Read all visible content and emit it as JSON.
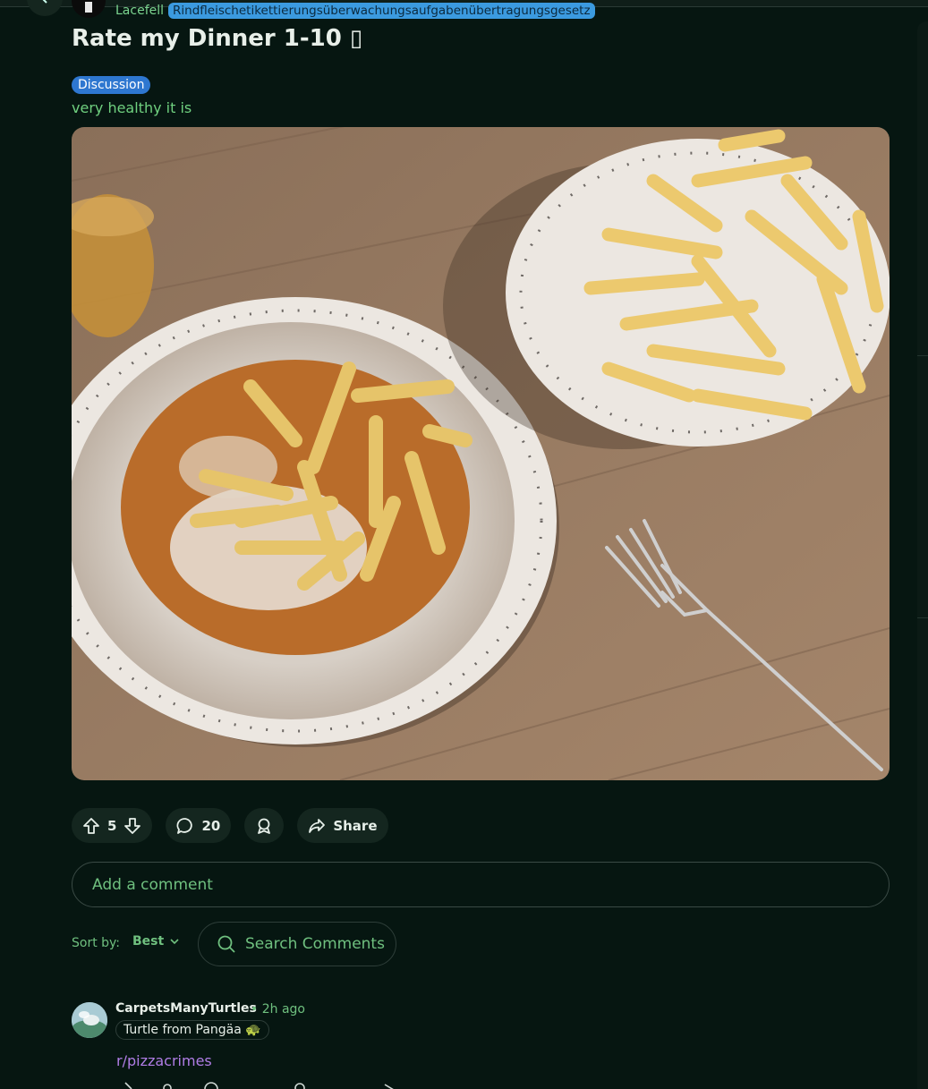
{
  "post": {
    "community_name": "Lacefell",
    "author_flair": "Rindfleischetikettierungsüberwachungsaufgabenübertragungsgesetz",
    "title": "Rate my Dinner 1-10 ▯",
    "tag": "Discussion",
    "body": "very healthy it is",
    "upvotes": "5",
    "comments_count": "20",
    "share_label": "Share"
  },
  "comment_box": {
    "placeholder": "Add a comment"
  },
  "sort": {
    "label": "Sort by:",
    "value": "Best"
  },
  "search": {
    "placeholder": "Search Comments"
  },
  "comments": [
    {
      "author": "CarpetsManyTurtles",
      "time": "• 2h ago",
      "flair": "Turtle from Pangäa 🐢",
      "text": "r/pizzacrimes"
    }
  ],
  "colors": {
    "background": "#061611",
    "accent_green": "#6fd07f",
    "tag_blue": "#2e77d0",
    "flair_blue": "#3b9adf",
    "link_purple": "#b07de6"
  }
}
